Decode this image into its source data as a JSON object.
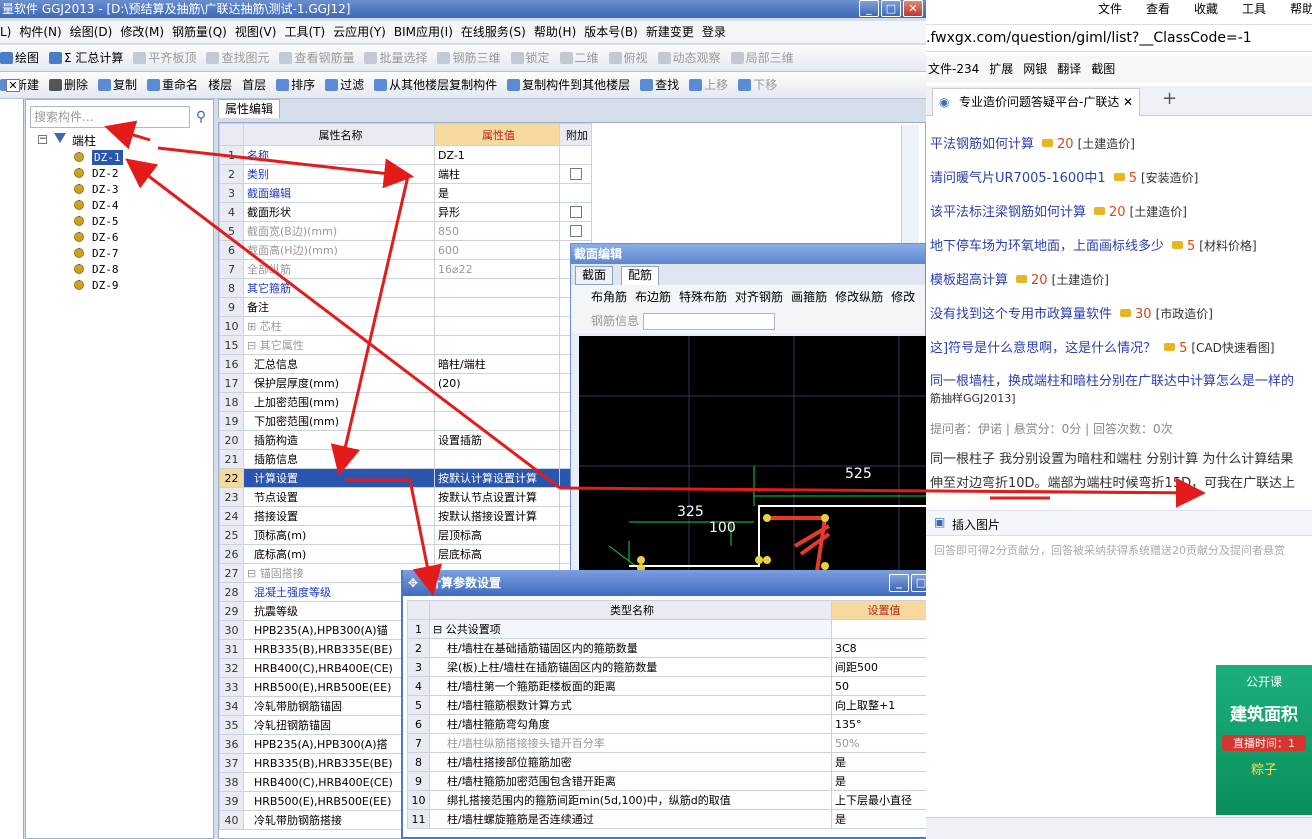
{
  "window": {
    "title": "量软件 GGJ2013 - [D:\\预结算及抽筋\\广联达抽筋\\测试-1.GGJ12]"
  },
  "menu": [
    "L)",
    "构件(N)",
    "绘图(D)",
    "修改(M)",
    "钢筋量(Q)",
    "视图(V)",
    "工具(T)",
    "云应用(Y)",
    "BIM应用(I)",
    "在线服务(S)",
    "帮助(H)",
    "版本号(B)",
    "新建变更",
    "登录"
  ],
  "toolbar1": {
    "items": [
      "绘图",
      "Σ 汇总计算",
      "平齐板顶",
      "查找图元",
      "查看钢筋量",
      "批量选择",
      "钢筋三维",
      "锁定",
      "二维",
      "俯视",
      "动态观察",
      "局部三维"
    ]
  },
  "toolbar2": {
    "items": [
      "新建",
      "删除",
      "复制",
      "重命名",
      "楼层",
      "首层",
      "排序",
      "过滤",
      "从其他楼层复制构件",
      "复制构件到其他楼层",
      "查找",
      "上移",
      "下移"
    ]
  },
  "tree": {
    "search_placeholder": "搜索构件...",
    "root": "端柱",
    "items": [
      "DZ-1",
      "DZ-2",
      "DZ-3",
      "DZ-4",
      "DZ-5",
      "DZ-6",
      "DZ-7",
      "DZ-8",
      "DZ-9"
    ],
    "selected": "DZ-1"
  },
  "props": {
    "tab": "属性编辑",
    "headers": [
      "属性名称",
      "属性值",
      "附加"
    ],
    "rows": [
      {
        "n": "1",
        "name": "名称",
        "val": "DZ-1",
        "cls": "blue",
        "cb": false
      },
      {
        "n": "2",
        "name": "类别",
        "val": "端柱",
        "cls": "blue",
        "cb": true
      },
      {
        "n": "3",
        "name": "截面编辑",
        "val": "是",
        "cls": "blue",
        "cb": false
      },
      {
        "n": "4",
        "name": "截面形状",
        "val": "异形",
        "cls": "",
        "cb": true
      },
      {
        "n": "5",
        "name": "截面宽(B边)(mm)",
        "val": "850",
        "cls": "gray",
        "cb": true
      },
      {
        "n": "6",
        "name": "截面高(H边)(mm)",
        "val": "600",
        "cls": "gray",
        "cb": false
      },
      {
        "n": "7",
        "name": "全部纵筋",
        "val": "16⌀22",
        "cls": "gray",
        "cb": false
      },
      {
        "n": "8",
        "name": "其它箍筋",
        "val": "",
        "cls": "blue",
        "cb": false
      },
      {
        "n": "9",
        "name": "备注",
        "val": "",
        "cls": "",
        "cb": false
      },
      {
        "n": "10",
        "name": "⊞ 芯柱",
        "val": "",
        "cls": "gray",
        "cb": false
      },
      {
        "n": "15",
        "name": "⊟ 其它属性",
        "val": "",
        "cls": "gray",
        "cb": false
      },
      {
        "n": "16",
        "name": "  汇总信息",
        "val": "暗柱/端柱",
        "cls": "",
        "cb": false
      },
      {
        "n": "17",
        "name": "  保护层厚度(mm)",
        "val": "(20)",
        "cls": "",
        "cb": false
      },
      {
        "n": "18",
        "name": "  上加密范围(mm)",
        "val": "",
        "cls": "",
        "cb": false
      },
      {
        "n": "19",
        "name": "  下加密范围(mm)",
        "val": "",
        "cls": "",
        "cb": false
      },
      {
        "n": "20",
        "name": "  插筋构造",
        "val": "设置插筋",
        "cls": "",
        "cb": false
      },
      {
        "n": "21",
        "name": "  插筋信息",
        "val": "",
        "cls": "",
        "cb": false
      },
      {
        "n": "22",
        "name": "  计算设置",
        "val": "按默认计算设置计算",
        "cls": "sel",
        "cb": false
      },
      {
        "n": "23",
        "name": "  节点设置",
        "val": "按默认节点设置计算",
        "cls": "",
        "cb": false
      },
      {
        "n": "24",
        "name": "  搭接设置",
        "val": "按默认搭接设置计算",
        "cls": "",
        "cb": false
      },
      {
        "n": "25",
        "name": "  顶标高(m)",
        "val": "层顶标高",
        "cls": "",
        "cb": false
      },
      {
        "n": "26",
        "name": "  底标高(m)",
        "val": "层底标高",
        "cls": "",
        "cb": false
      },
      {
        "n": "27",
        "name": "⊟ 锚固搭接",
        "val": "",
        "cls": "gray",
        "cb": false
      },
      {
        "n": "28",
        "name": "  混凝土强度等级",
        "val": "",
        "cls": "blue",
        "cb": false
      },
      {
        "n": "29",
        "name": "  抗震等级",
        "val": "",
        "cls": "",
        "cb": false
      },
      {
        "n": "30",
        "name": "  HPB235(A),HPB300(A)锚",
        "val": "",
        "cls": "",
        "cb": false
      },
      {
        "n": "31",
        "name": "  HRB335(B),HRB335E(BE)",
        "val": "",
        "cls": "",
        "cb": false
      },
      {
        "n": "32",
        "name": "  HRB400(C),HRB400E(CE)",
        "val": "",
        "cls": "",
        "cb": false
      },
      {
        "n": "33",
        "name": "  HRB500(E),HRB500E(EE)",
        "val": "",
        "cls": "",
        "cb": false
      },
      {
        "n": "34",
        "name": "  冷轧带肋钢筋锚固",
        "val": "",
        "cls": "",
        "cb": false
      },
      {
        "n": "35",
        "name": "  冷轧扭钢筋锚固",
        "val": "",
        "cls": "",
        "cb": false
      },
      {
        "n": "36",
        "name": "  HPB235(A),HPB300(A)搭",
        "val": "",
        "cls": "",
        "cb": false
      },
      {
        "n": "37",
        "name": "  HRB335(B),HRB335E(BE)",
        "val": "",
        "cls": "",
        "cb": false
      },
      {
        "n": "38",
        "name": "  HRB400(C),HRB400E(CE)",
        "val": "",
        "cls": "",
        "cb": false
      },
      {
        "n": "39",
        "name": "  HRB500(E),HRB500E(EE)",
        "val": "",
        "cls": "",
        "cb": false
      },
      {
        "n": "40",
        "name": "  冷轧带肋钢筋搭接",
        "val": "",
        "cls": "",
        "cb": false
      }
    ]
  },
  "section": {
    "title": "截面编辑",
    "tabs": [
      "截面",
      "配筋"
    ],
    "tools": [
      "布角筋",
      "布边筋",
      "特殊布筋",
      "对齐钢筋",
      "画箍筋",
      "修改纵筋",
      "修改"
    ],
    "info_label": "钢筋信息",
    "dims": [
      "525",
      "325",
      "100"
    ]
  },
  "calc": {
    "title": "计算参数设置",
    "headers": [
      "类型名称",
      "设置值"
    ],
    "rows": [
      {
        "n": "1",
        "name": "⊟ 公共设置项",
        "val": "",
        "gray": false
      },
      {
        "n": "2",
        "name": "    柱/墙柱在基础插筋锚固区内的箍筋数量",
        "val": "3C8",
        "gray": false
      },
      {
        "n": "3",
        "name": "    梁(板)上柱/墙柱在插筋锚固区内的箍筋数量",
        "val": "间距500",
        "gray": false
      },
      {
        "n": "4",
        "name": "    柱/墙柱第一个箍筋距楼板面的距离",
        "val": "50",
        "gray": false
      },
      {
        "n": "5",
        "name": "    柱/墙柱箍筋根数计算方式",
        "val": "向上取整+1",
        "gray": false
      },
      {
        "n": "6",
        "name": "    柱/墙柱箍筋弯勾角度",
        "val": "135°",
        "gray": false
      },
      {
        "n": "7",
        "name": "    柱/墙柱纵筋搭接接头错开百分率",
        "val": "50%",
        "gray": true
      },
      {
        "n": "8",
        "name": "    柱/墙柱搭接部位箍筋加密",
        "val": "是",
        "gray": false
      },
      {
        "n": "9",
        "name": "    柱/墙柱箍筋加密范围包含错开距离",
        "val": "是",
        "gray": false
      },
      {
        "n": "10",
        "name": "    绑扎搭接范围内的箍筋间距min(5d,100)中，纵筋d的取值",
        "val": "上下层最小直径",
        "gray": false
      },
      {
        "n": "11",
        "name": "    柱/墙柱螺旋箍筋是否连续通过",
        "val": "是",
        "gray": false
      }
    ]
  },
  "browser": {
    "menu": [
      "文件",
      "查看",
      "收藏",
      "工具",
      "帮助"
    ],
    "url": ".fwxgx.com/question/giml/list?__ClassCode=-1",
    "bookmarks": [
      "文件-234",
      "扩展",
      "网银",
      "翻译",
      "截图"
    ],
    "tab_title": "专业造价问题答疑平台-广联达",
    "new_tab": "+",
    "questions": [
      {
        "text": "平法钢筋如何计算",
        "pts": "20",
        "cat": "[土建造价]"
      },
      {
        "text": "请问暖气片UR7005-1600中1",
        "pts": "5",
        "cat": "[安装造价]"
      },
      {
        "text": "该平法标注梁钢筋如何计算",
        "pts": "20",
        "cat": "[土建造价]"
      },
      {
        "text": "地下停车场为环氧地面，上面画标线多少",
        "pts": "5",
        "cat": "[材料价格]"
      },
      {
        "text": "模板超高计算",
        "pts": "20",
        "cat": "[土建造价]"
      },
      {
        "text": "没有找到这个专用市政算量软件",
        "pts": "30",
        "cat": "[市政造价]"
      },
      {
        "text": "这]符号是什么意思啊，这是什么情况？",
        "pts": "5",
        "cat": "[CAD快速看图]"
      }
    ],
    "detail_title": "同一根墙柱，换成端柱和暗柱分别在广联达中计算怎么是一样的",
    "detail_sub": "筋抽样GGJ2013]",
    "meta": "提问者：伊诺   |   悬赏分：0分   |   回答次数：0次",
    "body1": "同一根柱子 我分别设置为暗柱和端柱 分别计算  为什么计算结果",
    "body2": "伸至对边弯折10D。端部为端柱时候弯折15D，可我在广联达上",
    "insert_image": "插入图片",
    "answer_hint": "回答即可得2分贡献分，回答被采纳获得系统赠送20贡献分及提问者悬赏",
    "ad_title": "建筑面积",
    "ad_sub": "直播时间：1",
    "ad_tag": "粽子",
    "ad_logo": "公开课"
  }
}
